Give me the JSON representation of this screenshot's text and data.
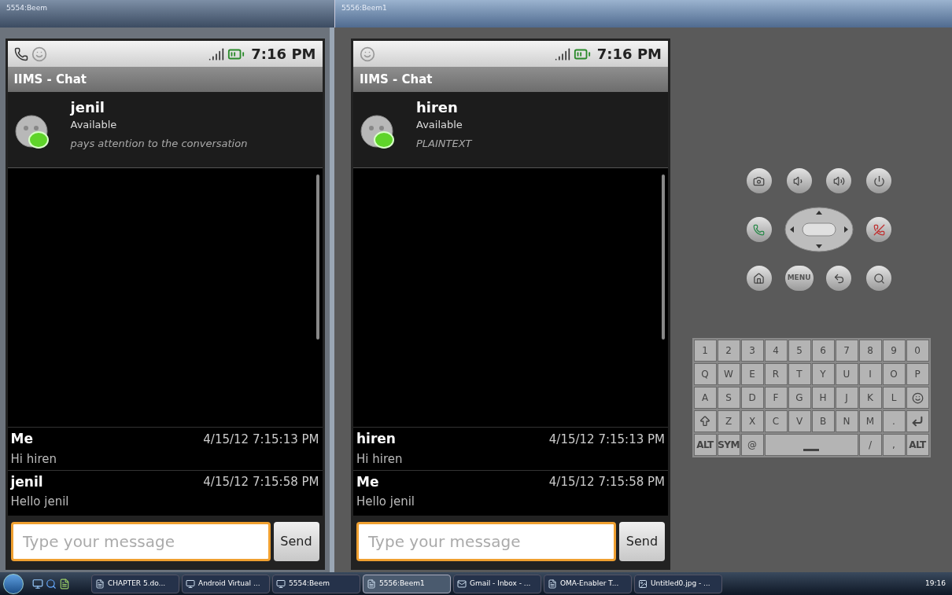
{
  "windows": [
    {
      "title": "5554:Beem",
      "selected": false,
      "phone": {
        "time": "7:16 PM",
        "app_title": "IIMS - Chat",
        "contact": {
          "name": "jenil",
          "status": "Available",
          "note": "pays attention to the conversation"
        },
        "messages": [
          {
            "sender": "Me",
            "time": "4/15/12 7:15:13 PM",
            "text": "Hi hiren"
          },
          {
            "sender": "jenil",
            "time": "4/15/12 7:15:58 PM",
            "text": "Hello jenil"
          }
        ],
        "input": {
          "placeholder": "Type your message"
        },
        "send": "Send"
      }
    },
    {
      "title": "5556:Beem1",
      "selected": true,
      "phone": {
        "time": "7:16 PM",
        "app_title": "IIMS - Chat",
        "contact": {
          "name": "hiren",
          "status": "Available",
          "note": "PLAINTEXT"
        },
        "messages": [
          {
            "sender": "hiren",
            "time": "4/15/12 7:15:13 PM",
            "text": "Hi hiren"
          },
          {
            "sender": "Me",
            "time": "4/15/12 7:15:58 PM",
            "text": "Hello jenil"
          }
        ],
        "input": {
          "placeholder": "Type your message"
        },
        "send": "Send"
      }
    }
  ],
  "controls": {
    "menu_label": "MENU"
  },
  "keyboard": {
    "rows": [
      [
        {
          "kind": "char",
          "label": "1"
        },
        {
          "kind": "char",
          "label": "2"
        },
        {
          "kind": "char",
          "label": "3"
        },
        {
          "kind": "char",
          "label": "4"
        },
        {
          "kind": "char",
          "label": "5"
        },
        {
          "kind": "char",
          "label": "6"
        },
        {
          "kind": "char",
          "label": "7"
        },
        {
          "kind": "char",
          "label": "8"
        },
        {
          "kind": "char",
          "label": "9"
        },
        {
          "kind": "char",
          "label": "0"
        }
      ],
      [
        {
          "kind": "char",
          "label": "Q"
        },
        {
          "kind": "char",
          "label": "W"
        },
        {
          "kind": "char",
          "label": "E"
        },
        {
          "kind": "char",
          "label": "R"
        },
        {
          "kind": "char",
          "label": "T"
        },
        {
          "kind": "char",
          "label": "Y"
        },
        {
          "kind": "char",
          "label": "U"
        },
        {
          "kind": "char",
          "label": "I"
        },
        {
          "kind": "char",
          "label": "O"
        },
        {
          "kind": "char",
          "label": "P"
        }
      ],
      [
        {
          "kind": "char",
          "label": "A"
        },
        {
          "kind": "char",
          "label": "S"
        },
        {
          "kind": "char",
          "label": "D"
        },
        {
          "kind": "char",
          "label": "F"
        },
        {
          "kind": "char",
          "label": "G"
        },
        {
          "kind": "char",
          "label": "H"
        },
        {
          "kind": "char",
          "label": "J"
        },
        {
          "kind": "char",
          "label": "K"
        },
        {
          "kind": "char",
          "label": "L"
        },
        {
          "kind": "smiley"
        }
      ],
      [
        {
          "kind": "shift"
        },
        {
          "kind": "char",
          "label": "Z"
        },
        {
          "kind": "char",
          "label": "X"
        },
        {
          "kind": "char",
          "label": "C"
        },
        {
          "kind": "char",
          "label": "V"
        },
        {
          "kind": "char",
          "label": "B"
        },
        {
          "kind": "char",
          "label": "N"
        },
        {
          "kind": "char",
          "label": "M"
        },
        {
          "kind": "char",
          "label": "."
        },
        {
          "kind": "enter"
        }
      ],
      [
        {
          "kind": "small",
          "label": "ALT"
        },
        {
          "kind": "small",
          "label": "SYM"
        },
        {
          "kind": "char",
          "label": "@"
        },
        {
          "kind": "space"
        },
        {
          "kind": "covered"
        },
        {
          "kind": "covered"
        },
        {
          "kind": "covered"
        },
        {
          "kind": "char",
          "label": "/"
        },
        {
          "kind": "char",
          "label": ","
        },
        {
          "kind": "small",
          "label": "ALT"
        }
      ]
    ]
  },
  "taskbar": {
    "items": [
      {
        "label": "CHAPTER 5.do...",
        "selected": false
      },
      {
        "label": "Android Virtual ...",
        "selected": false
      },
      {
        "label": "5554:Beem",
        "selected": false
      },
      {
        "label": "5556:Beem1",
        "selected": true
      },
      {
        "label": "Gmail - Inbox - ...",
        "selected": false
      },
      {
        "label": "OMA-Enabler T...",
        "selected": false
      },
      {
        "label": "Untitled0.jpg - ...",
        "selected": false
      }
    ],
    "clock": "19:16"
  }
}
